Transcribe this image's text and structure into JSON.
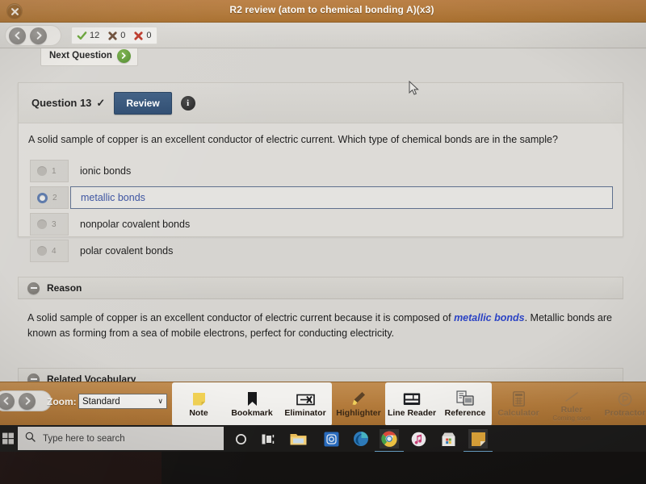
{
  "window": {
    "title": "R2 review (atom to chemical bonding A)(x3)",
    "close_icon": "close-circle-icon"
  },
  "topbar": {
    "back_icon": "arrow-left-icon",
    "forward_icon": "arrow-right-icon",
    "scores": [
      {
        "icon": "green-check-icon",
        "value": "12"
      },
      {
        "icon": "dark-x-icon",
        "value": "0"
      },
      {
        "icon": "red-x-icon",
        "value": "0"
      }
    ]
  },
  "next_question": {
    "label": "Next Question",
    "icon": "green-arrow-right-icon"
  },
  "question": {
    "number_label": "Question 13",
    "answered_check": "✓",
    "review_label": "Review",
    "info_label": "i",
    "stem": "A solid sample of copper is an excellent conductor of electric current. Which type of chemical bonds are in the sample?",
    "options": [
      {
        "index": "1",
        "text": "ionic bonds",
        "selected": false
      },
      {
        "index": "2",
        "text": "metallic bonds",
        "selected": true
      },
      {
        "index": "3",
        "text": "nonpolar covalent bonds",
        "selected": false
      },
      {
        "index": "4",
        "text": "polar covalent bonds",
        "selected": false
      }
    ]
  },
  "reason": {
    "section_label": "Reason",
    "text_before": "A solid sample of copper is an excellent conductor of electric current because it is composed of ",
    "keyword": "metallic bonds",
    "text_after": ".  Metallic bonds are known as forming from a sea of mobile electrons, perfect for conducting electricity."
  },
  "related_vocabulary": {
    "section_label": "Related Vocabulary"
  },
  "toolbar": {
    "back_icon": "arrow-left-icon",
    "forward_icon": "arrow-right-icon",
    "zoom_label": "Zoom:",
    "zoom_value": "Standard",
    "zoom_caret": "∨",
    "tools": [
      {
        "label": "Note",
        "icon": "sticky-note-icon",
        "state": "enabled",
        "bg": "white",
        "sub": ""
      },
      {
        "label": "Bookmark",
        "icon": "bookmark-icon",
        "state": "enabled",
        "bg": "white",
        "sub": ""
      },
      {
        "label": "Eliminator",
        "icon": "eliminator-icon",
        "state": "enabled",
        "bg": "white",
        "sub": ""
      },
      {
        "label": "Highlighter",
        "icon": "highlighter-icon",
        "state": "enabled",
        "bg": "orange",
        "sub": ""
      },
      {
        "label": "Line Reader",
        "icon": "line-reader-icon",
        "state": "enabled",
        "bg": "white",
        "sub": ""
      },
      {
        "label": "Reference",
        "icon": "reference-icon",
        "state": "enabled",
        "bg": "white",
        "sub": ""
      },
      {
        "label": "Calculator",
        "icon": "calculator-icon",
        "state": "disabled",
        "bg": "orange",
        "sub": ""
      },
      {
        "label": "Ruler",
        "icon": "ruler-icon",
        "state": "disabled",
        "bg": "orange",
        "sub": "Coming soon"
      },
      {
        "label": "Protractor",
        "icon": "protractor-icon",
        "state": "disabled",
        "bg": "orange",
        "sub": ""
      }
    ]
  },
  "taskbar": {
    "start_icon": "windows-start-icon",
    "search_icon": "search-icon",
    "search_placeholder": "Type here to search",
    "icons": [
      {
        "name": "cortana-icon"
      },
      {
        "name": "task-view-icon"
      },
      {
        "name": "file-explorer-icon"
      },
      {
        "name": "instagram-icon"
      },
      {
        "name": "microsoft-edge-icon"
      },
      {
        "name": "google-chrome-icon",
        "active": true
      },
      {
        "name": "itunes-icon"
      },
      {
        "name": "microsoft-store-icon"
      },
      {
        "name": "sticky-notes-icon"
      }
    ]
  },
  "colors": {
    "header_brown": "#b57c3f",
    "accent_blue": "#3a52a0",
    "review_blue": "#2f4d72",
    "keyword_blue": "#2b43c4",
    "check_green": "#5d9637",
    "error_red": "#b83226"
  }
}
